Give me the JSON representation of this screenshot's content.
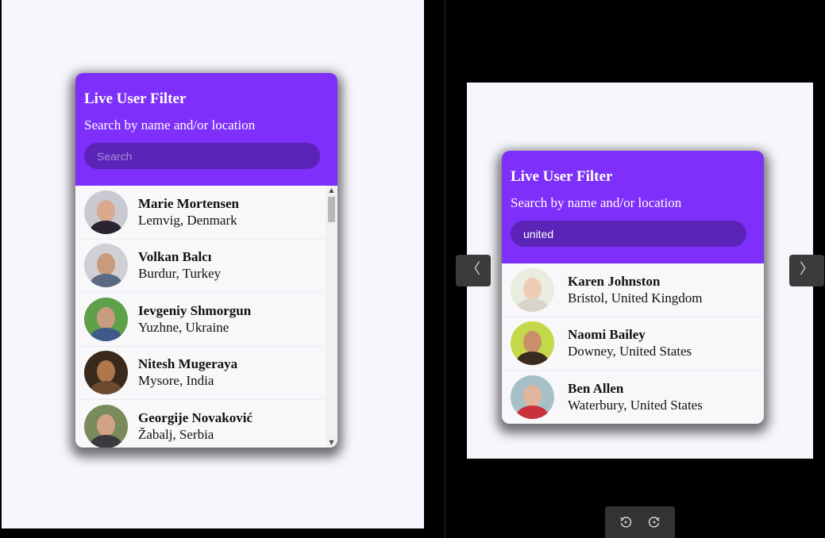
{
  "left_widget": {
    "title": "Live User Filter",
    "subtitle": "Search by name and/or location",
    "search": {
      "placeholder": "Search",
      "value": ""
    },
    "users": [
      {
        "name": "Marie Mortensen",
        "location": "Lemvig, Denmark"
      },
      {
        "name": "Volkan Balcı",
        "location": "Burdur, Turkey"
      },
      {
        "name": "Ievgeniy Shmorgun",
        "location": "Yuzhne, Ukraine"
      },
      {
        "name": "Nitesh Mugeraya",
        "location": "Mysore, India"
      },
      {
        "name": "Georgije Novaković",
        "location": "Žabalj, Serbia"
      }
    ]
  },
  "right_widget": {
    "title": "Live User Filter",
    "subtitle": "Search by name and/or location",
    "search": {
      "placeholder": "Search",
      "value": "united"
    },
    "users": [
      {
        "name": "Karen Johnston",
        "location": "Bristol, United Kingdom"
      },
      {
        "name": "Naomi Bailey",
        "location": "Downey, United States"
      },
      {
        "name": "Ben Allen",
        "location": "Waterbury, United States"
      }
    ]
  },
  "viewer": {
    "prev_icon": "chevron-left-icon",
    "next_icon": "chevron-right-icon",
    "rotate_left_icon": "rotate-left-icon",
    "rotate_right_icon": "rotate-right-icon"
  },
  "colors": {
    "header": "#7e30fa",
    "search_bg": "#5b23b8"
  }
}
